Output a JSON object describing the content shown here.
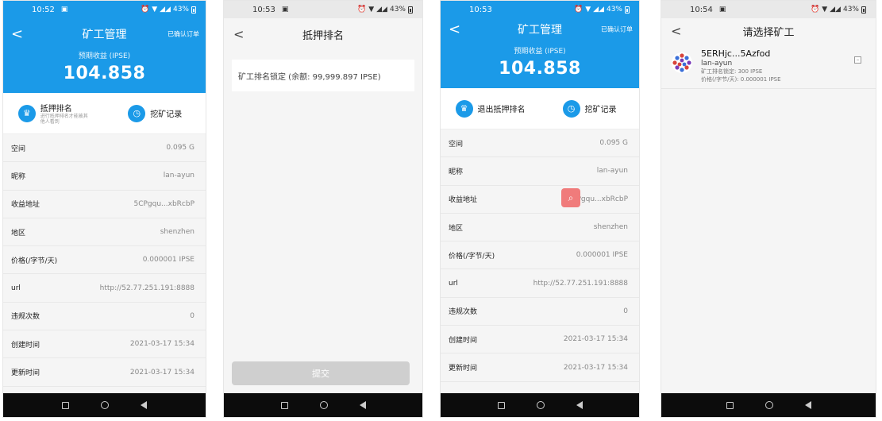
{
  "phones": {
    "p1": {
      "status": {
        "time": "10:52",
        "battery": "43%"
      },
      "nav": {
        "back": "<",
        "title": "矿工管理",
        "right": "已确认订单"
      },
      "earnings": {
        "label": "预期收益 (IPSE)",
        "value": "104.858"
      },
      "actions": {
        "stake": {
          "title": "抵押排名",
          "sub": "进行抵押排名才能被其他人看到"
        },
        "mining": {
          "title": "挖矿记录"
        }
      },
      "rows": [
        {
          "k": "空间",
          "v": "0.095 G"
        },
        {
          "k": "昵称",
          "v": "lan-ayun"
        },
        {
          "k": "收益地址",
          "v": "5CPgqu...xbRcbP"
        },
        {
          "k": "地区",
          "v": "shenzhen"
        },
        {
          "k": "价格(/字节/天)",
          "v": "0.000001 IPSE"
        },
        {
          "k": "url",
          "v": "http://52.77.251.191:8888"
        },
        {
          "k": "违规次数",
          "v": "0"
        },
        {
          "k": "创建时间",
          "v": "2021-03-17 15:34"
        },
        {
          "k": "更新时间",
          "v": "2021-03-17 15:34"
        }
      ]
    },
    "p2": {
      "status": {
        "time": "10:53",
        "battery": "43%"
      },
      "nav": {
        "back": "<",
        "title": "抵押排名"
      },
      "field": "矿工排名锁定 (余额: 99,999.897 IPSE)",
      "submit": "提交"
    },
    "p3": {
      "status": {
        "time": "10:53",
        "battery": "43%"
      },
      "nav": {
        "back": "<",
        "title": "矿工管理",
        "right": "已确认订单"
      },
      "earnings": {
        "label": "预期收益 (IPSE)",
        "value": "104.858"
      },
      "actions": {
        "stake": {
          "title": "退出抵押排名"
        },
        "mining": {
          "title": "挖矿记录"
        }
      },
      "rows": [
        {
          "k": "空间",
          "v": "0.095 G"
        },
        {
          "k": "昵称",
          "v": "lan-ayun"
        },
        {
          "k": "收益地址",
          "v": "5CPgqu...xbRcbP"
        },
        {
          "k": "地区",
          "v": "shenzhen"
        },
        {
          "k": "价格(/字节/天)",
          "v": "0.000001 IPSE"
        },
        {
          "k": "url",
          "v": "http://52.77.251.191:8888"
        },
        {
          "k": "违规次数",
          "v": "0"
        },
        {
          "k": "创建时间",
          "v": "2021-03-17 15:34"
        },
        {
          "k": "更新时间",
          "v": "2021-03-17 15:34"
        }
      ]
    },
    "p4": {
      "status": {
        "time": "10:54",
        "battery": "43%"
      },
      "nav": {
        "back": "<",
        "title": "请选择矿工"
      },
      "miner": {
        "name": "5ERHjc...5Azfod",
        "nick": "lan-ayun",
        "lock": "矿工排名锁定: 300 IPSE",
        "price": "价格(/字节/天): 0.000001 IPSE"
      }
    }
  },
  "colors": {
    "brand_blue": "#1b9ae8",
    "magnifier": "#f07b7b"
  }
}
